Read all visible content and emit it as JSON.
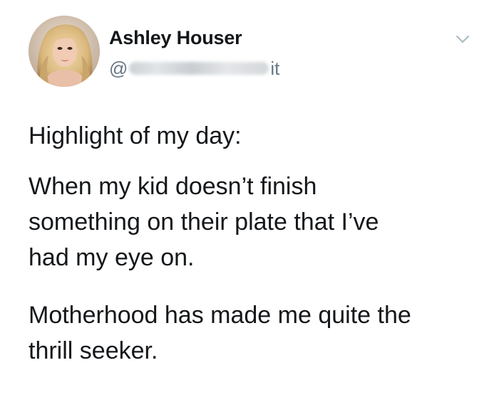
{
  "tweet": {
    "display_name": "Ashley Houser",
    "handle_prefix": "@",
    "handle_suffix": "it",
    "paragraphs": [
      [
        "Highlight of my day:"
      ],
      [
        "When my kid doesn’t finish",
        "something on their plate that I’ve",
        "had my eye on."
      ],
      [
        "Motherhood has made me quite the",
        "thrill seeker."
      ]
    ]
  },
  "icons": {
    "menu": "chevron-down-icon",
    "avatar": "avatar"
  },
  "colors": {
    "text": "#14171a",
    "secondary": "#657786",
    "chevron": "#aab8c2",
    "background": "#ffffff"
  }
}
